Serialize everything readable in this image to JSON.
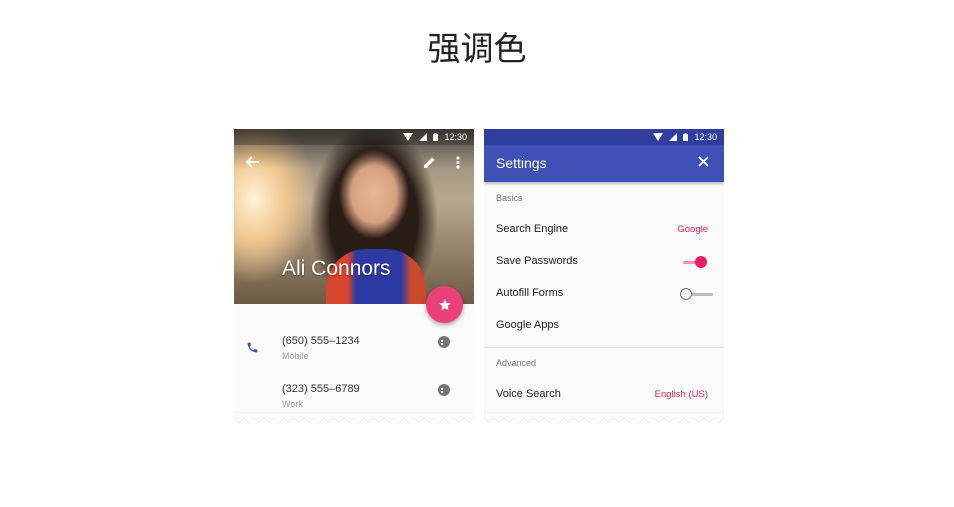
{
  "page": {
    "title": "强调色"
  },
  "contact_screen": {
    "status_time": "12:30",
    "name": "Ali Connors",
    "phones": [
      {
        "number": "(650) 555–1234",
        "type": "Mobile"
      },
      {
        "number": "(323) 555–6789",
        "type": "Work"
      }
    ],
    "accent_color": "#ec407a"
  },
  "settings_screen": {
    "status_time": "12:30",
    "title": "Settings",
    "sections": [
      {
        "label": "Basics"
      },
      {
        "label": "Advanced"
      }
    ],
    "rows": {
      "search_engine": {
        "label": "Search Engine",
        "value": "Google"
      },
      "save_passwords": {
        "label": "Save Passwords",
        "toggle": true
      },
      "autofill_forms": {
        "label": "Autofill Forms",
        "toggle": false
      },
      "google_apps": {
        "label": "Google Apps"
      },
      "voice_search": {
        "label": "Voice Search",
        "value": "English (US)"
      }
    },
    "primary_color": "#3f51b5",
    "accent_color": "#e91e63"
  }
}
